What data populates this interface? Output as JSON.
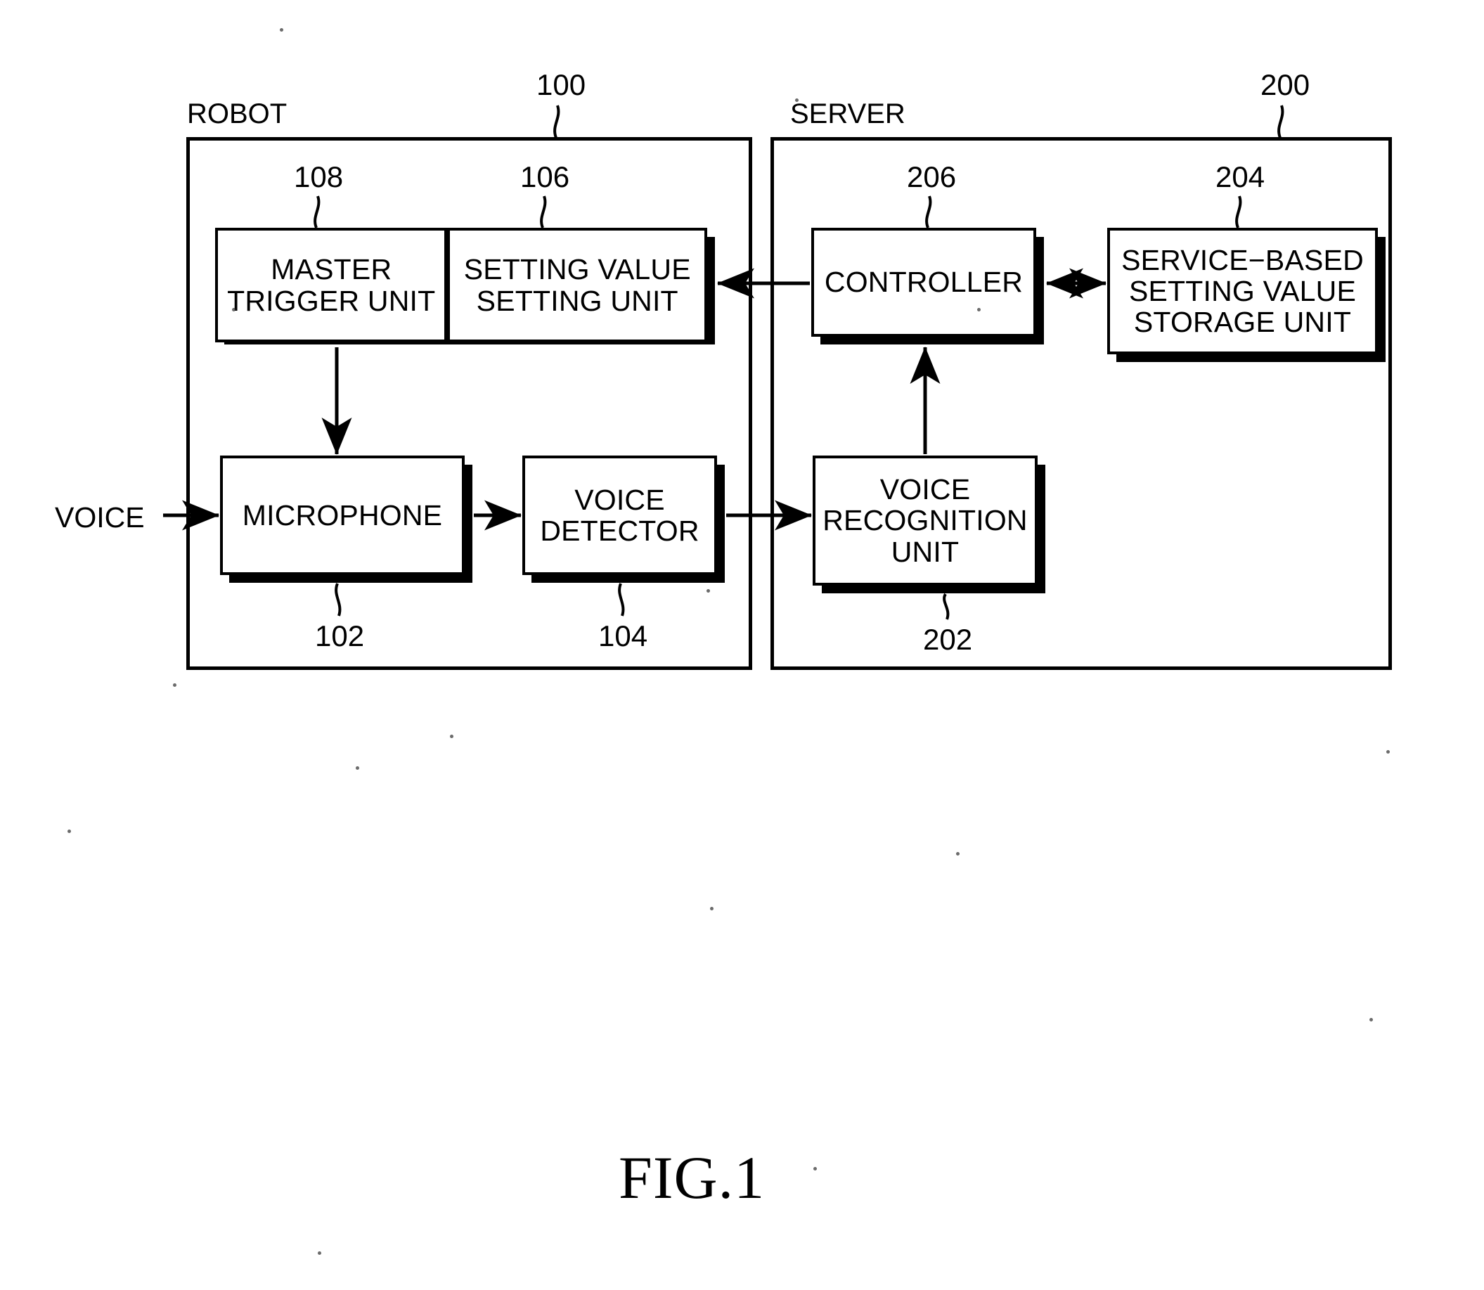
{
  "figure": {
    "caption": "FIG.1"
  },
  "containers": [
    {
      "id": "robot",
      "label": "ROBOT",
      "ref": "100"
    },
    {
      "id": "server",
      "label": "SERVER",
      "ref": "200"
    }
  ],
  "blocks": [
    {
      "id": "master-trigger-unit",
      "text": "MASTER\nTRIGGER UNIT",
      "ref": "108"
    },
    {
      "id": "setting-value-setting-unit",
      "text": "SETTING VALUE\nSETTING UNIT",
      "ref": "106"
    },
    {
      "id": "microphone",
      "text": "MICROPHONE",
      "ref": "102"
    },
    {
      "id": "voice-detector",
      "text": "VOICE\nDETECTOR",
      "ref": "104"
    },
    {
      "id": "controller",
      "text": "CONTROLLER",
      "ref": "206"
    },
    {
      "id": "service-based-setting-value-storage-unit",
      "text": "SERVICE−BASED\nSETTING VALUE\nSTORAGE UNIT",
      "ref": "204"
    },
    {
      "id": "voice-recognition-unit",
      "text": "VOICE\nRECOGNITION\nUNIT",
      "ref": "202"
    }
  ],
  "signals": {
    "voice_input": "VOICE"
  },
  "colors": {
    "ink": "#000000",
    "paper": "#ffffff"
  }
}
